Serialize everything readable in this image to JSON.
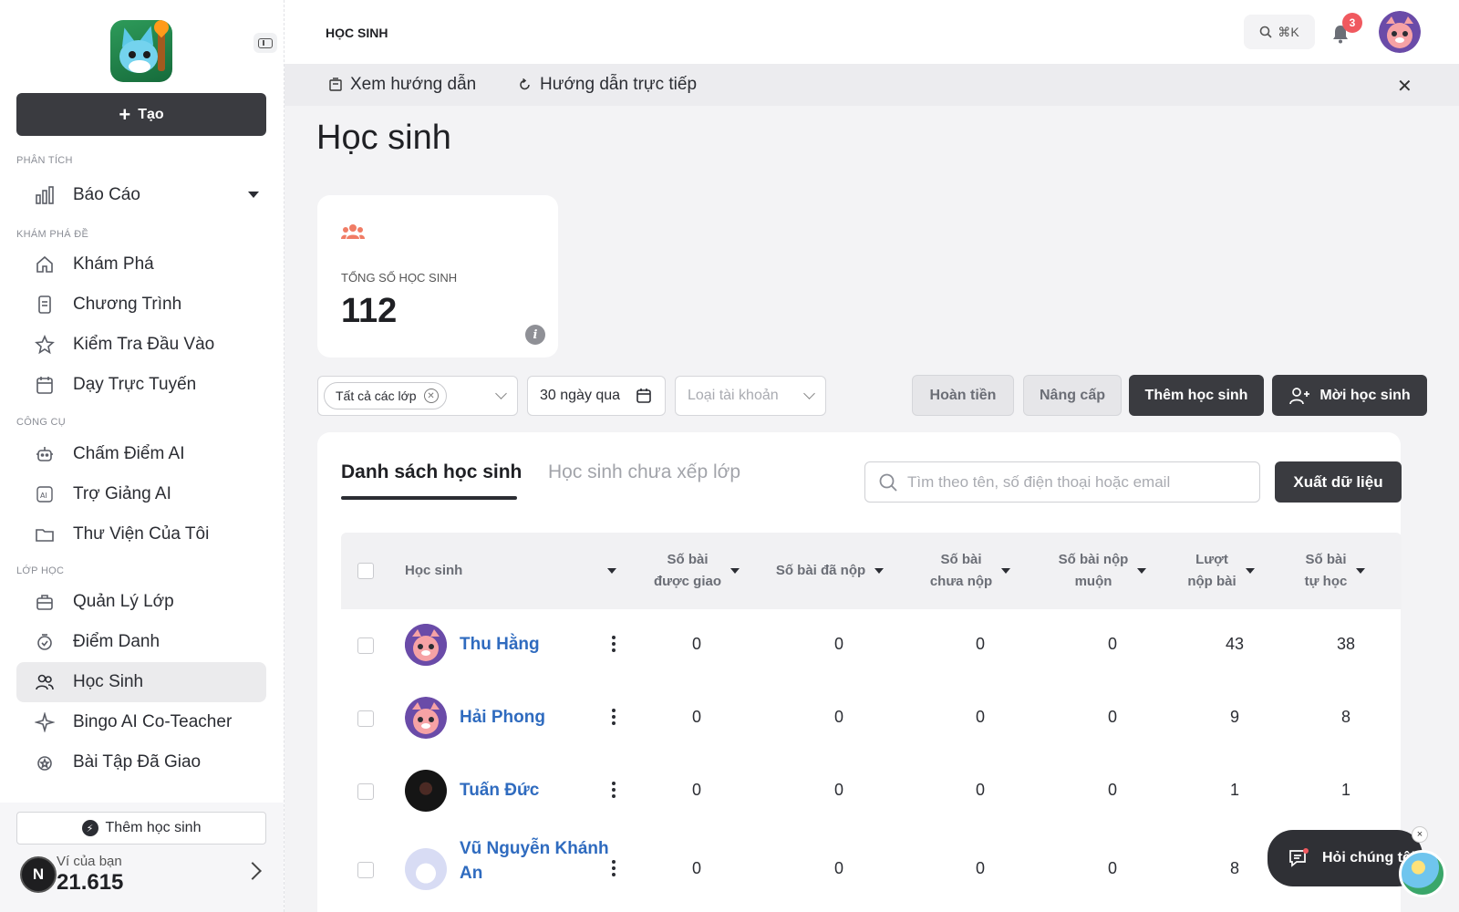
{
  "sidebar": {
    "create_label": "Tạo",
    "sections": {
      "analysis": "PHÂN TÍCH",
      "explore": "KHÁM PHÁ ĐỀ",
      "tools": "CÔNG CỤ",
      "classes": "LỚP HỌC"
    },
    "items": {
      "reports": "Báo Cáo",
      "explore": "Khám Phá",
      "programs": "Chương Trình",
      "entrance_test": "Kiểm Tra Đầu Vào",
      "online_teaching": "Dạy Trực Tuyến",
      "ai_grading": "Chấm Điểm AI",
      "ai_assistant": "Trợ Giảng AI",
      "my_library": "Thư Viện Của Tôi",
      "class_management": "Quản Lý Lớp",
      "attendance": "Điểm Danh",
      "students": "Học Sinh",
      "bingo": "Bingo AI Co-Teacher",
      "assignments": "Bài Tập Đã Giao"
    },
    "add_student_label": "Thêm học sinh",
    "balance_label": "Ví của bạn",
    "balance_value": "21.615",
    "badge_letter": "N"
  },
  "header": {
    "breadcrumb": "HỌC SINH",
    "search_shortcut": "⌘K",
    "notification_count": "3"
  },
  "guide_bar": {
    "view_guide": "Xem hướng dẫn",
    "live_guide": "Hướng dẫn trực tiếp"
  },
  "main": {
    "title": "Học sinh",
    "stat": {
      "label": "TỔNG SỐ HỌC SINH",
      "value": "112",
      "info": "i"
    },
    "filters": {
      "class_chip": "Tất cả các lớp",
      "date_range": "30 ngày qua",
      "account_type_placeholder": "Loại tài khoản"
    },
    "actions": {
      "refund": "Hoàn tiền",
      "upgrade": "Nâng cấp",
      "add_student": "Thêm học sinh",
      "invite_student": "Mời học sinh"
    },
    "tabs": {
      "student_list": "Danh sách học sinh",
      "unassigned": "Học sinh chưa xếp lớp"
    },
    "search_placeholder": "Tìm theo tên, số điện thoại hoặc email",
    "export_label": "Xuất dữ liệu",
    "table": {
      "headers": {
        "student": "Học sinh",
        "assigned": "Số bài\nđược giao",
        "submitted": "Số bài đã nộp",
        "not_submitted": "Số bài\nchưa nộp",
        "late": "Số bài nộp\nmuộn",
        "submissions": "Lượt\nnộp bài",
        "self_study": "Số bài\ntự học"
      },
      "rows": [
        {
          "name": "Thu Hằng",
          "assigned": "0",
          "submitted": "0",
          "not_submitted": "0",
          "late": "0",
          "submissions": "43",
          "self_study": "38"
        },
        {
          "name": "Hải Phong",
          "assigned": "0",
          "submitted": "0",
          "not_submitted": "0",
          "late": "0",
          "submissions": "9",
          "self_study": "8"
        },
        {
          "name": "Tuấn Đức",
          "assigned": "0",
          "submitted": "0",
          "not_submitted": "0",
          "late": "0",
          "submissions": "1",
          "self_study": "1"
        },
        {
          "name": "Vũ Nguyễn Khánh An",
          "assigned": "0",
          "submitted": "0",
          "not_submitted": "0",
          "late": "0",
          "submissions": "8",
          "self_study": ""
        }
      ]
    }
  },
  "chat": {
    "label": "Hỏi chúng tôi",
    "close": "×"
  },
  "colors": {
    "primary_dark": "#3a3b40",
    "link_blue": "#2f6bbf",
    "badge_red": "#f0595f",
    "stat_icon": "#f07c65"
  },
  "icons": {
    "reports": "bar-chart-icon",
    "explore": "home-icon",
    "programs": "document-icon",
    "entrance_test": "star-icon",
    "online_teaching": "calendar-icon",
    "ai_grading": "robot-icon",
    "ai_assistant": "ai-icon",
    "my_library": "folder-icon",
    "class_management": "briefcase-icon",
    "attendance": "badge-check-icon",
    "students": "users-icon",
    "bingo": "sparkle-icon",
    "assignments": "badge-check-icon"
  }
}
